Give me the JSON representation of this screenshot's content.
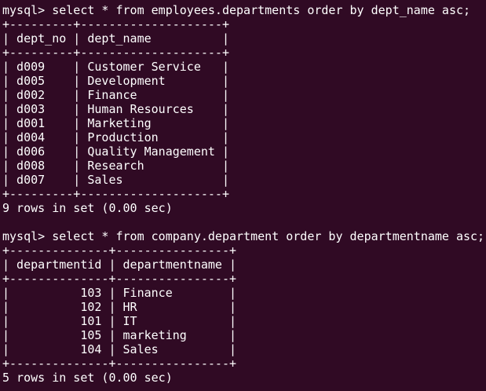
{
  "terminal": {
    "background_color": "#300a24",
    "text_color": "#ffffff",
    "lines": [
      "mysql> select * from employees.departments order by dept_name asc;",
      "+---------+--------------------+",
      "| dept_no | dept_name          |",
      "+---------+--------------------+",
      "| d009    | Customer Service   |",
      "| d005    | Development        |",
      "| d002    | Finance            |",
      "| d003    | Human Resources    |",
      "| d001    | Marketing          |",
      "| d004    | Production         |",
      "| d006    | Quality Management |",
      "| d008    | Research           |",
      "| d007    | Sales              |",
      "+---------+--------------------+",
      "9 rows in set (0.00 sec)",
      "",
      "mysql> select * from company.department order by departmentname asc;",
      "+--------------+----------------+",
      "| departmentid | departmentname |",
      "+--------------+----------------+",
      "|          103 | Finance        |",
      "|          102 | HR             |",
      "|          101 | IT             |",
      "|          105 | marketing      |",
      "|          104 | Sales          |",
      "+--------------+----------------+",
      "5 rows in set (0.00 sec)"
    ]
  }
}
